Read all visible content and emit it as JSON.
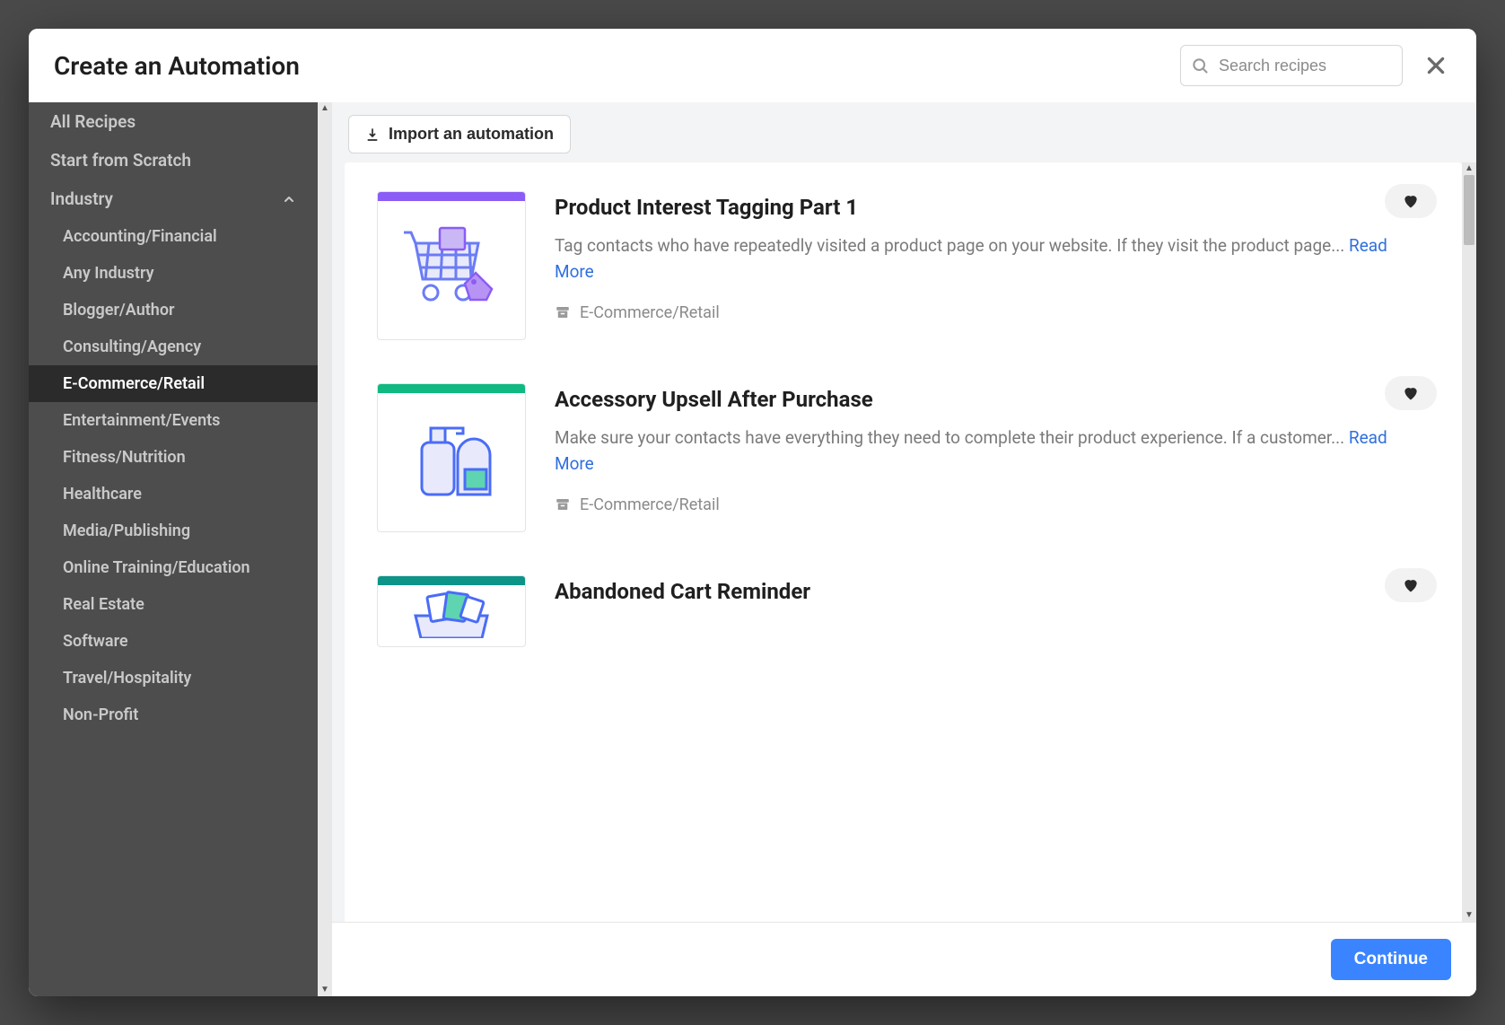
{
  "modal": {
    "title": "Create an Automation",
    "search_placeholder": "Search recipes",
    "import_label": "Import an automation",
    "continue_label": "Continue"
  },
  "sidebar": {
    "items": [
      {
        "label": "All Recipes"
      },
      {
        "label": "Start from Scratch"
      }
    ],
    "group_label": "Industry",
    "sub_items": [
      {
        "label": "Accounting/Financial"
      },
      {
        "label": "Any Industry"
      },
      {
        "label": "Blogger/Author"
      },
      {
        "label": "Consulting/Agency"
      },
      {
        "label": "E-Commerce/Retail",
        "active": true
      },
      {
        "label": "Entertainment/Events"
      },
      {
        "label": "Fitness/Nutrition"
      },
      {
        "label": "Healthcare"
      },
      {
        "label": "Media/Publishing"
      },
      {
        "label": "Online Training/Education"
      },
      {
        "label": "Real Estate"
      },
      {
        "label": "Software"
      },
      {
        "label": "Travel/Hospitality"
      },
      {
        "label": "Non-Profit"
      }
    ]
  },
  "recipes": [
    {
      "title": "Product Interest Tagging Part 1",
      "desc": "Tag contacts who have repeatedly visited a product page on your website. If they visit the product page... ",
      "readmore": "Read More",
      "tag": "E-Commerce/Retail",
      "bar_color": "#8B5CF6"
    },
    {
      "title": "Accessory Upsell After Purchase",
      "desc": "Make sure your contacts have everything they need to complete their product experience. If a customer... ",
      "readmore": "Read More",
      "tag": "E-Commerce/Retail",
      "bar_color": "#10B981"
    },
    {
      "title": "Abandoned Cart Reminder",
      "desc": "",
      "readmore": "",
      "tag": "",
      "bar_color": "#0D9488"
    }
  ]
}
